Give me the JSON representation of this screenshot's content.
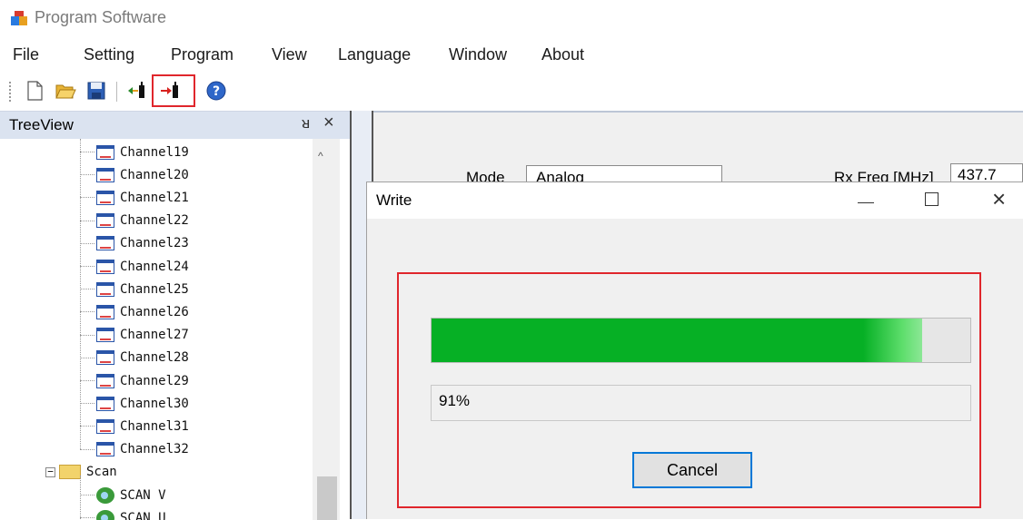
{
  "window": {
    "title": "Program Software"
  },
  "menu": [
    "File",
    "Setting",
    "Program",
    "View",
    "Language",
    "Window",
    "About"
  ],
  "toolbar": {
    "buttons": [
      "new-file-icon",
      "open-folder-icon",
      "save-icon",
      "read-from-radio-icon",
      "write-to-radio-icon",
      "help-icon"
    ]
  },
  "treeview": {
    "title": "TreeView",
    "pin_glyph": "ᴚ",
    "close_glyph": "×",
    "channels": [
      "Channel19",
      "Channel20",
      "Channel21",
      "Channel22",
      "Channel23",
      "Channel24",
      "Channel25",
      "Channel26",
      "Channel27",
      "Channel28",
      "Channel29",
      "Channel30",
      "Channel31",
      "Channel32"
    ],
    "folder": {
      "label": "Scan",
      "expander": "−"
    },
    "scan_items": [
      "SCAN V",
      "SCAN U"
    ]
  },
  "form": {
    "mode_label": "Mode",
    "mode_value": "Analog",
    "rx_label": "Rx Freq [MHz]",
    "rx_value": "437.7"
  },
  "dialog": {
    "title": "Write",
    "progress": 0.91,
    "progress_text": "91%",
    "cancel_label": "Cancel"
  },
  "colors": {
    "progress_green": "#06b025",
    "highlight_red": "#e0262c",
    "focus_blue": "#0078d7"
  }
}
